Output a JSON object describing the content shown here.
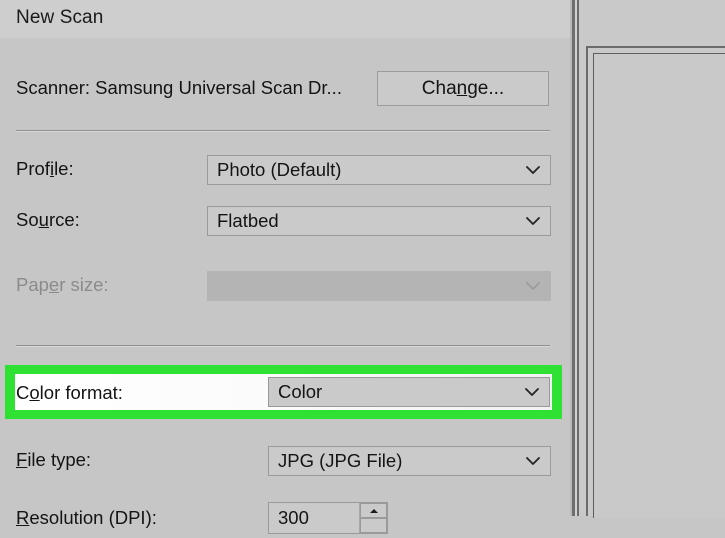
{
  "window": {
    "title": "New Scan",
    "accent_green": "#2fe132",
    "dialog_bg": "#c6c6c6",
    "titlebar_bg": "#cecece"
  },
  "scanner": {
    "label": "Scanner: Samsung Universal Scan Dr...",
    "change_button": {
      "prefix": "Cha",
      "accel": "n",
      "suffix": "ge..."
    }
  },
  "fields": {
    "profile": {
      "label_prefix": "Prof",
      "label_accel": "i",
      "label_suffix": "le:",
      "value": "Photo (Default)",
      "enabled": true
    },
    "source": {
      "label_prefix": "So",
      "label_accel": "u",
      "label_suffix": "rce:",
      "value": "Flatbed",
      "enabled": true
    },
    "paper_size": {
      "label_prefix": "Pap",
      "label_accel": "e",
      "label_suffix": "r size:",
      "value": "",
      "enabled": false
    },
    "color_format": {
      "label_prefix": "C",
      "label_accel": "o",
      "label_suffix": "lor format:",
      "value": "Color",
      "enabled": true,
      "highlighted": true
    },
    "file_type": {
      "label_prefix": "",
      "label_accel": "F",
      "label_suffix": "ile type:",
      "value": "JPG (JPG File)",
      "enabled": true
    },
    "resolution": {
      "label_prefix": "",
      "label_accel": "R",
      "label_suffix": "esolution (DPI):",
      "value": "300",
      "enabled": true
    }
  },
  "icons": {
    "chevron_down": "chevron-down-icon",
    "spinner_up": "spinner-up-arrow-icon",
    "spinner_down": "spinner-down-arrow-icon"
  },
  "preview": {
    "label": ""
  }
}
